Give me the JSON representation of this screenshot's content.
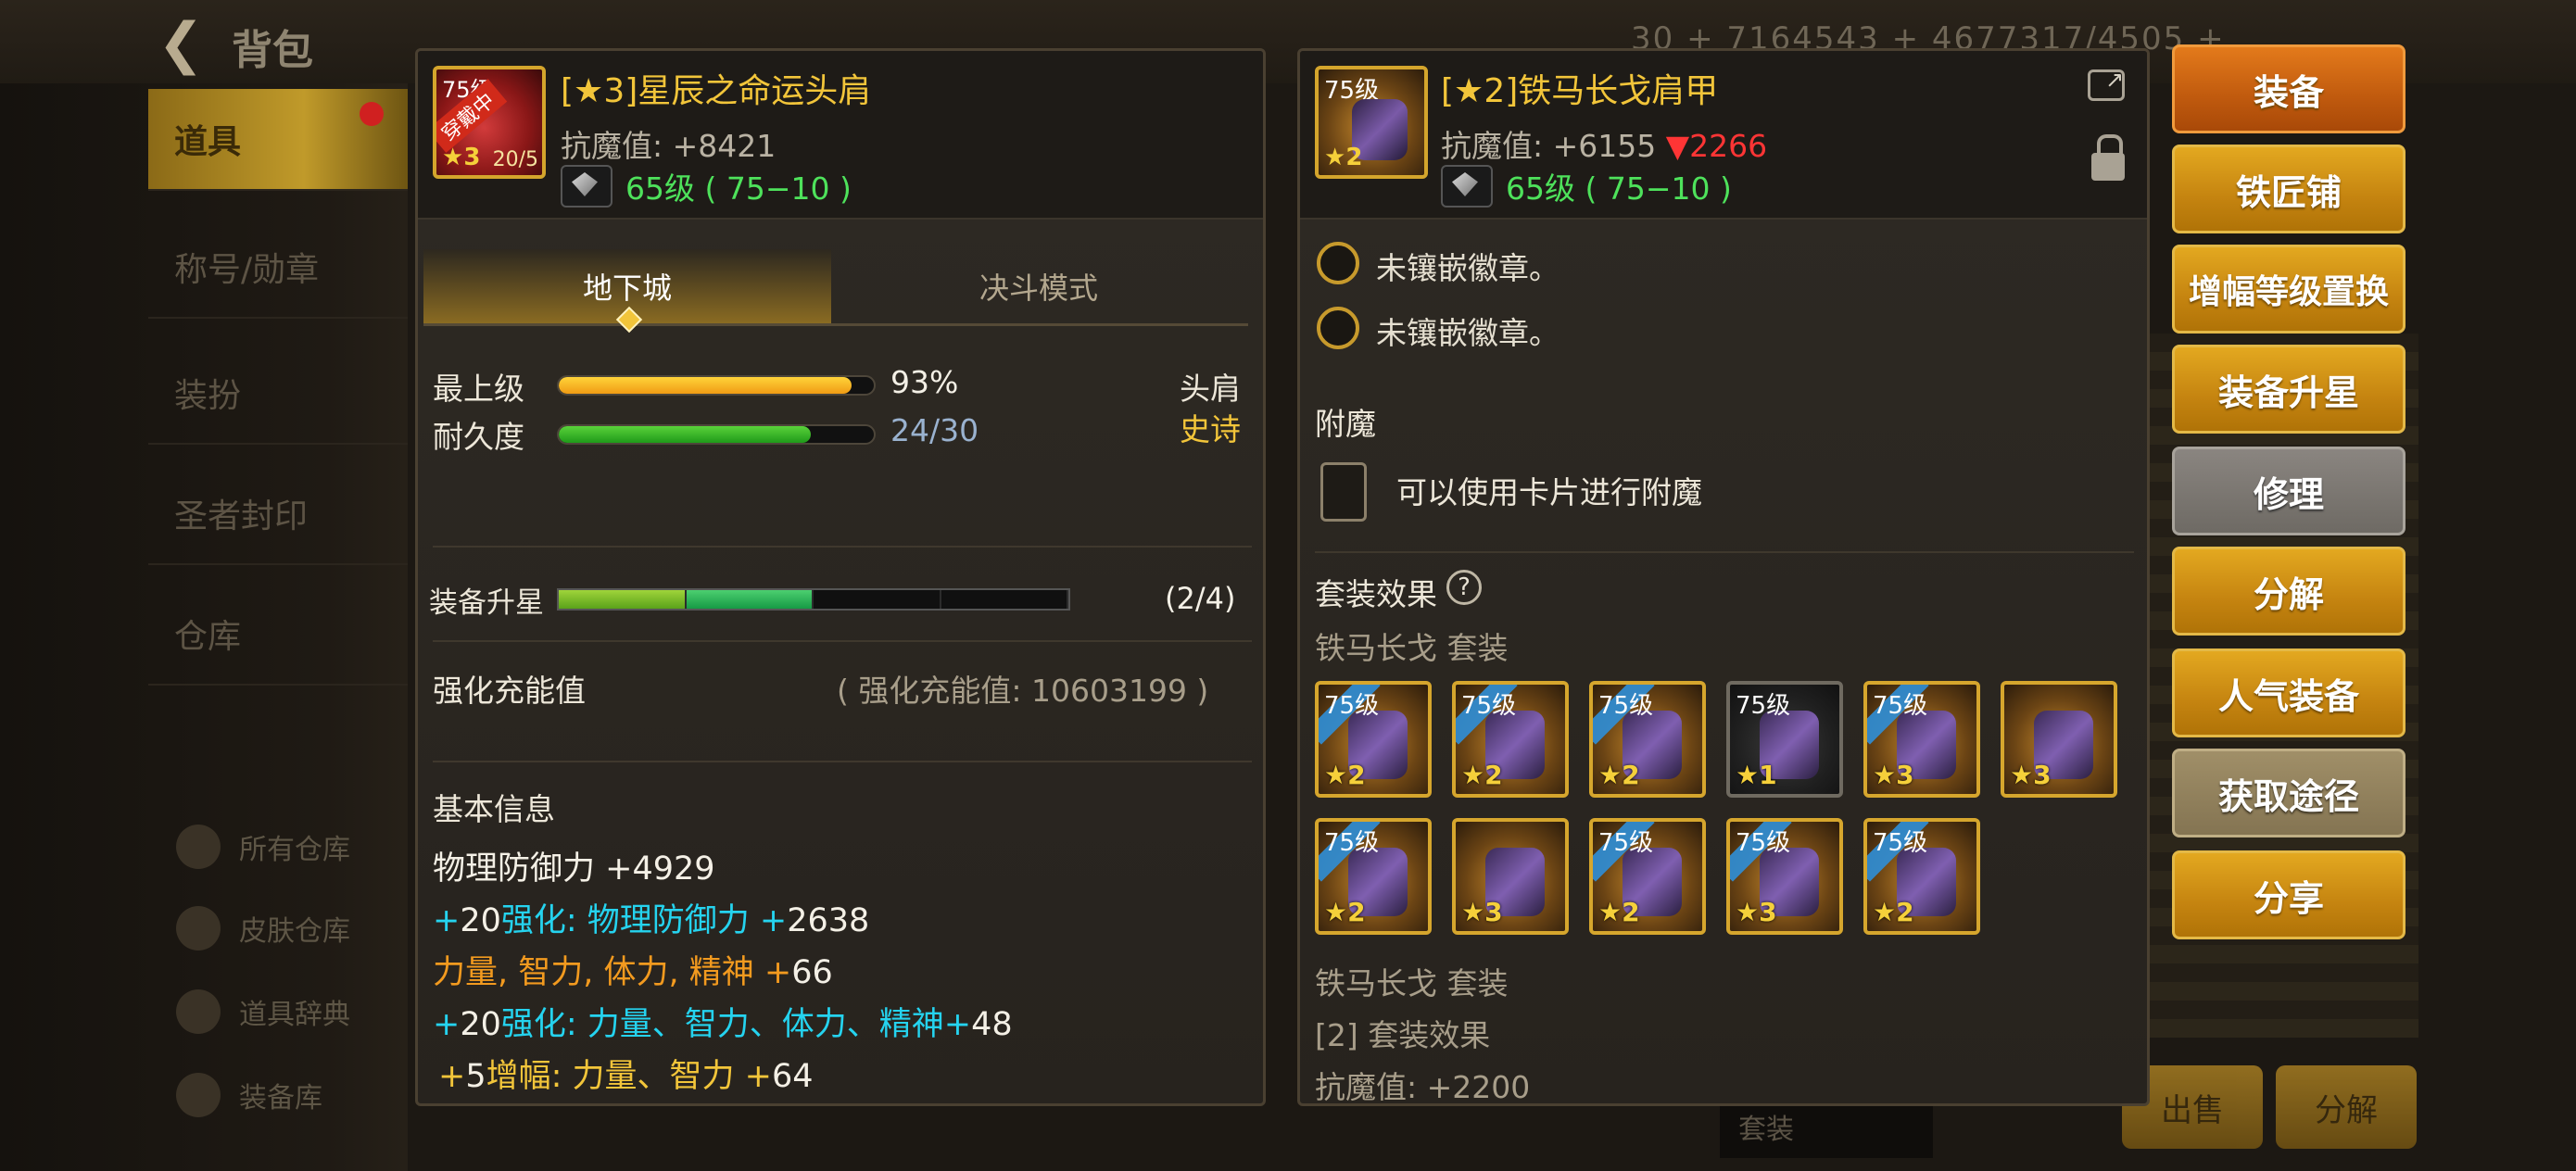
{
  "background": {
    "back_glyph": "❮",
    "title": "背包",
    "top_stats": "30 +     7164543 +     4677317/4505 +",
    "sidebar": [
      "道具",
      "称号/勋章",
      "装扮",
      "圣者封印",
      "仓库"
    ],
    "sidebar_sub": [
      "所有仓库",
      "皮肤仓库",
      "道具辞典",
      "装备库"
    ],
    "bottom_buttons": [
      "出售",
      "分解"
    ],
    "bottom_select": "套装"
  },
  "left_item": {
    "icon_level": "75级",
    "icon_badge": "穿戴中",
    "icon_star": "3",
    "icon_count": "20/5",
    "title": "[★3]星辰之命运头肩",
    "magic_resist": "抗魔值: +8421",
    "level_text": "65级 ( 75−10 )",
    "tabs": [
      "地下城",
      "决斗模式"
    ],
    "rows": {
      "top_label": "最上级",
      "top_pct": "93%",
      "top_value": 0.93,
      "dur_label": "耐久度",
      "dur_text": "24/30",
      "dur_value": 0.8,
      "slot": "头肩",
      "rarity": "史诗"
    },
    "star_upgrade": {
      "label": "装备升星",
      "count": "(2/4)"
    },
    "charge": {
      "label": "强化充能值",
      "value": "( 强化充能值: 10603199 )"
    },
    "basic_info_title": "基本信息",
    "info": {
      "line1_a": "物理防御力 +",
      "line1_b": "4929",
      "line2_a": "+",
      "line2_b": "20",
      "line2_c": "强化: 物理防御力 +",
      "line2_d": "2638",
      "line3_a": "力量, 智力, 体力, 精神 +",
      "line3_b": "66",
      "line4_a": "+",
      "line4_b": "20",
      "line4_c": "强化: 力量、智力、体力、精神+",
      "line4_d": "48",
      "line5_a": "+",
      "line5_b": "5",
      "line5_c": "增幅: 力量、智力 +",
      "line5_d": "64"
    }
  },
  "right_item": {
    "icon_level": "75级",
    "icon_star": "2",
    "title": "[★2]铁马长戈肩甲",
    "magic_resist_a": "抗魔值: +6155 ",
    "magic_resist_b": "▼2266",
    "level_text": "65级 ( 75−10 )",
    "sockets": [
      "未镶嵌徽章。",
      "未镶嵌徽章。"
    ],
    "enchant_title": "附魔",
    "enchant_text": "可以使用卡片进行附魔",
    "set_title": "套装效果",
    "set_help": "?",
    "set_name_1": "铁马长戈  套装",
    "set_items": [
      {
        "level": "75级",
        "star": "2",
        "worn": true
      },
      {
        "level": "75级",
        "star": "2",
        "worn": true
      },
      {
        "level": "75级",
        "star": "2",
        "worn": true
      },
      {
        "level": "75级",
        "star": "1",
        "worn": false
      },
      {
        "level": "75级",
        "star": "3",
        "worn": true
      },
      {
        "level": "",
        "star": "3",
        "worn": false
      },
      {
        "level": "75级",
        "star": "2",
        "worn": true
      },
      {
        "level": "",
        "star": "3",
        "worn": false
      },
      {
        "level": "75级",
        "star": "2",
        "worn": true
      },
      {
        "level": "75级",
        "star": "3",
        "worn": true
      },
      {
        "level": "75级",
        "star": "2",
        "worn": true
      }
    ],
    "set_name_2": "铁马长戈  套装",
    "set_effect": "[2] 套装效果",
    "set_bonus": "抗魔值: +2200"
  },
  "actions": [
    "装备",
    "铁匠铺",
    "增幅等级置换",
    "装备升星",
    "修理",
    "分解",
    "人气装备",
    "获取途径",
    "分享"
  ],
  "colors": {
    "gold": "#f2c53a",
    "green": "#4ee25b",
    "cyan": "#25d3ef",
    "orange": "#f29a1f",
    "red": "#ff3535",
    "button": "#c58410"
  }
}
